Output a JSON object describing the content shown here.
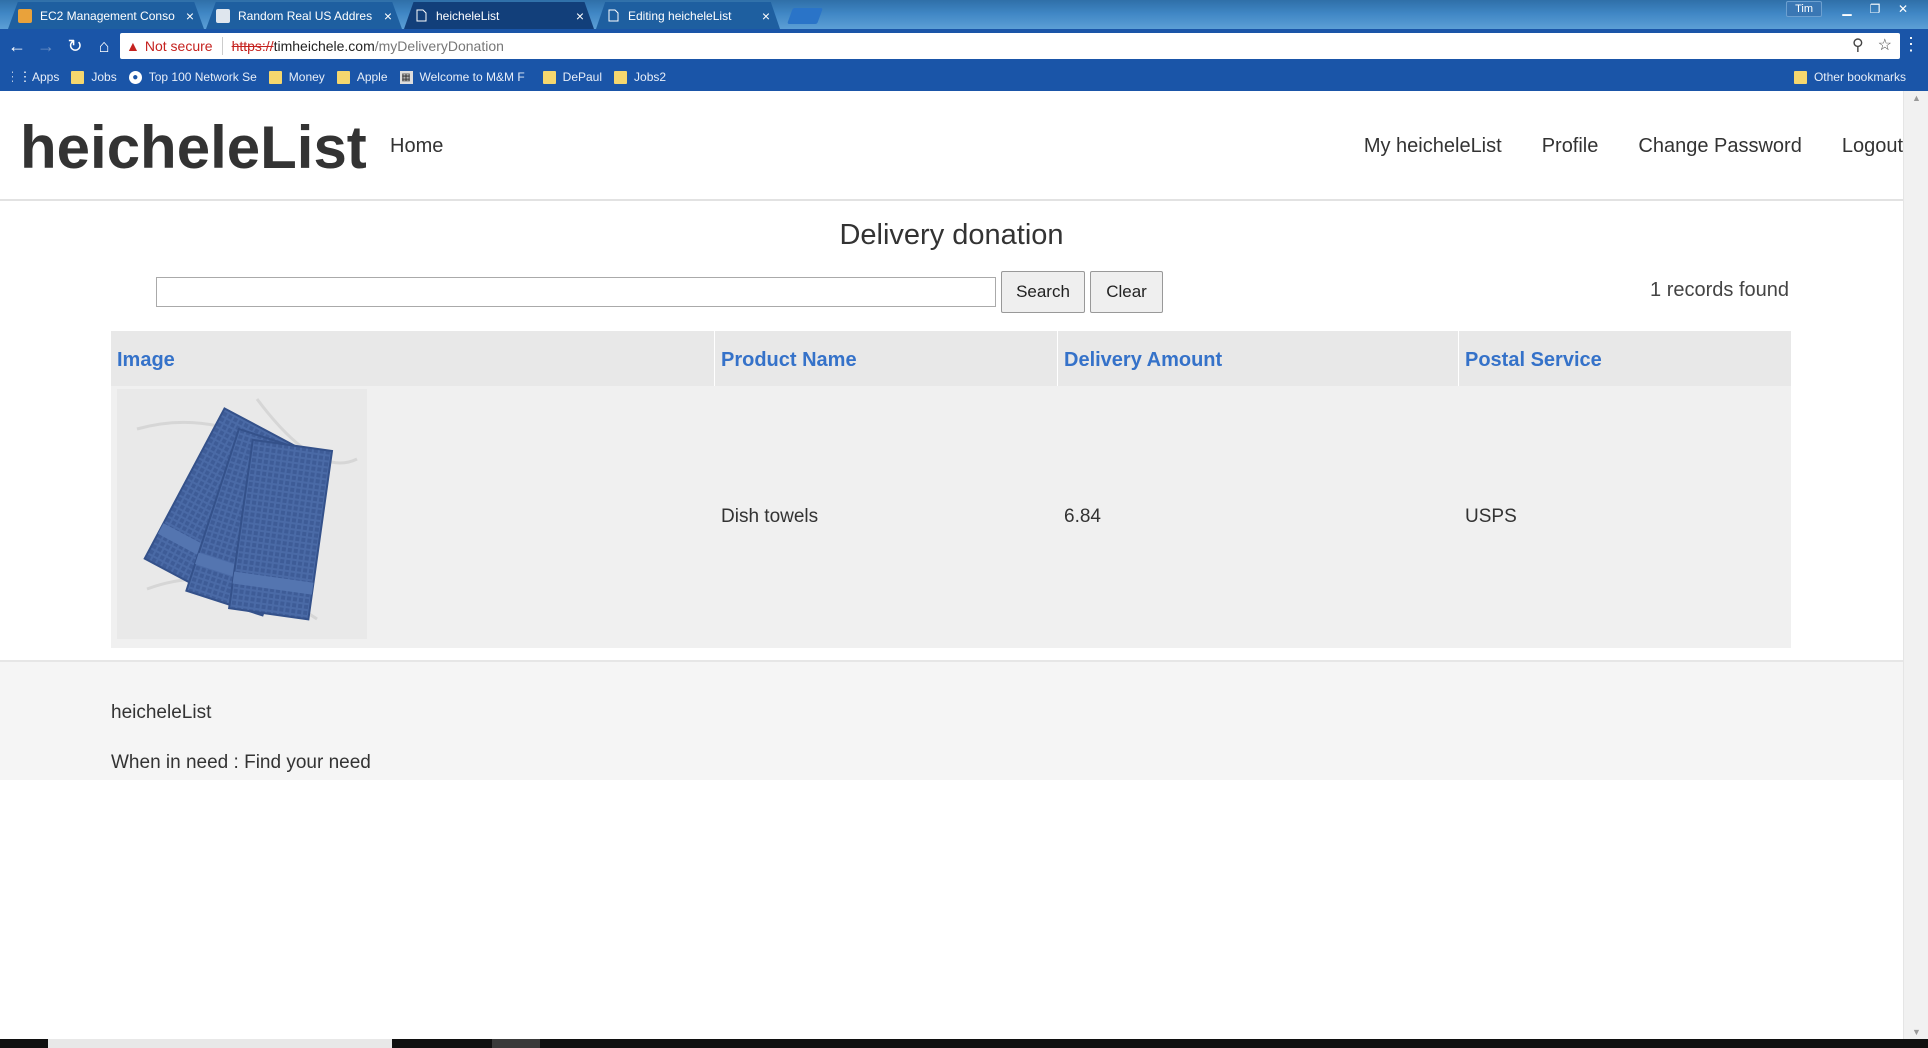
{
  "browser": {
    "tabs": [
      {
        "title": "EC2 Management Conso",
        "icon": "box-icon"
      },
      {
        "title": "Random Real US Addres",
        "icon": "page-icon"
      },
      {
        "title": "heicheleList",
        "icon": "document-icon",
        "active": true
      },
      {
        "title": "Editing heicheleList",
        "icon": "document-icon"
      }
    ],
    "profile_name": "Tim",
    "security_label": "Not secure",
    "url_scheme": "https://",
    "url_host": "timheichele.com",
    "url_path": "/myDeliveryDonation",
    "bookmarks": [
      {
        "label": "Apps",
        "icon": "apps-grid-icon"
      },
      {
        "label": "Jobs",
        "icon": "folder-icon"
      },
      {
        "label": "Top 100 Network Se",
        "icon": "site-icon"
      },
      {
        "label": "Money",
        "icon": "folder-icon"
      },
      {
        "label": "Apple",
        "icon": "folder-icon"
      },
      {
        "label": "Welcome to M&M F",
        "icon": "site-icon"
      },
      {
        "label": "DePaul",
        "icon": "folder-icon"
      },
      {
        "label": "Jobs2",
        "icon": "folder-icon"
      }
    ],
    "other_bookmarks": "Other bookmarks"
  },
  "site": {
    "brand": "heicheleList",
    "nav_home": "Home",
    "nav_right": [
      "My heicheleList",
      "Profile",
      "Change Password",
      "Logout"
    ]
  },
  "main": {
    "title": "Delivery donation",
    "search_value": "",
    "search_button": "Search",
    "clear_button": "Clear",
    "records_found": "1 records found",
    "table": {
      "headers": [
        "Image",
        "Product Name",
        "Delivery Amount",
        "Postal Service"
      ],
      "rows": [
        {
          "image": "dish-towels-photo",
          "product_name": "Dish towels",
          "delivery_amount": "6.84",
          "postal_service": "USPS"
        }
      ]
    }
  },
  "footer": {
    "brand": "heicheleList",
    "tagline": "When in need : Find your need"
  },
  "colors": {
    "header_link": "#3572c9",
    "chrome_blue": "#1a55a8",
    "towel_blue": "#4a6aa6"
  }
}
